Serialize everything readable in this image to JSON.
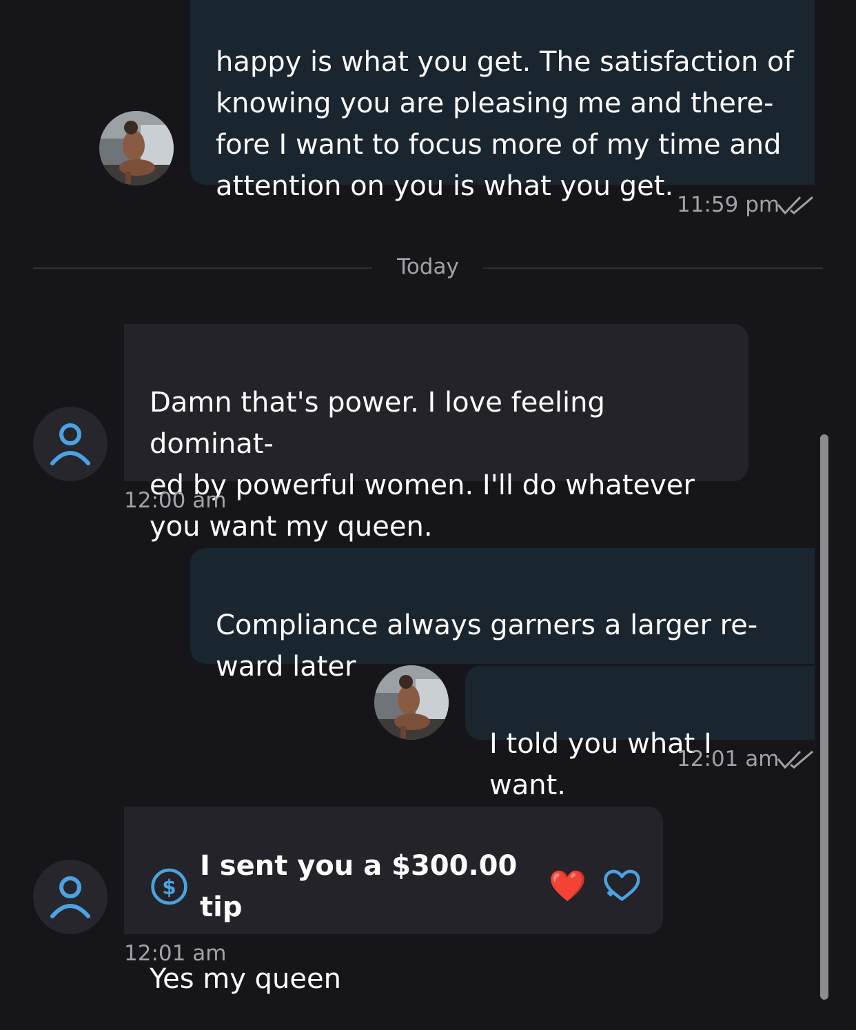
{
  "messages": [
    {
      "direction": "outgoing",
      "text": "happy is what you get. The satisfaction of\nknowing you are pleasing me and there-\nfore I want to focus more of my time and\nattention on you is what you get.",
      "time": "11:59 pm",
      "read": true
    },
    {
      "direction": "incoming",
      "text": "Damn that's power. I love feeling dominat-\ned by powerful women. I'll do whatever\nyou want my queen.",
      "time": "12:00 am"
    },
    {
      "direction": "outgoing",
      "text": "Compliance always garners a larger re-\nward later"
    },
    {
      "direction": "outgoing",
      "text": "I told you what I want.",
      "time": "12:01 am",
      "read": true
    },
    {
      "direction": "incoming",
      "tip": {
        "text": "I sent you a $300.00 tip",
        "emoji": "❤️",
        "icon": "dollar-circle-icon",
        "reaction_icon": "heart-reaction-icon"
      },
      "text": "Yes my queen",
      "time": "12:01 am"
    }
  ],
  "date_divider": "Today",
  "colors": {
    "background": "#16161a",
    "outgoing_bubble": "#19252f",
    "incoming_bubble": "#232329",
    "accent": "#4ba3e3",
    "timestamp": "#a2a2a8"
  }
}
